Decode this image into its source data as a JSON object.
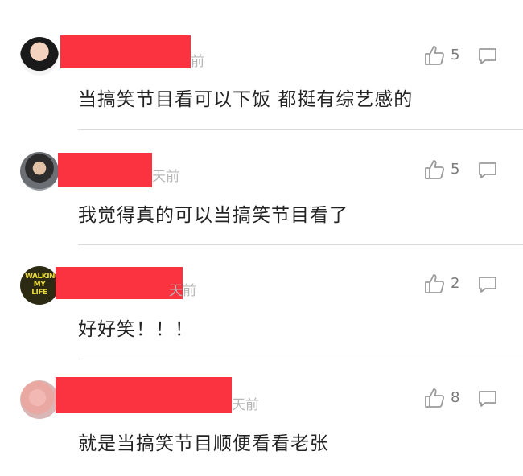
{
  "comments": [
    {
      "time": "前",
      "likes": "5",
      "text": "当搞笑节目看可以下饭 都挺有综艺感的"
    },
    {
      "time": "天前",
      "likes": "5",
      "text": "我觉得真的可以当搞笑节目看了"
    },
    {
      "time": "天前",
      "likes": "2",
      "text": "好好笑！！！",
      "avatar_text": "WALKING MY LIFE"
    },
    {
      "time": "天前",
      "likes": "8",
      "text": "就是当搞笑节目顺便看看老张"
    }
  ],
  "colors": {
    "redaction": "#fb3341",
    "divider": "#dadada",
    "icon": "#9b9b9b",
    "meta": "#b7b7b7"
  },
  "icons": {
    "like": "thumbs-up-icon",
    "reply": "comment-bubble-icon"
  }
}
